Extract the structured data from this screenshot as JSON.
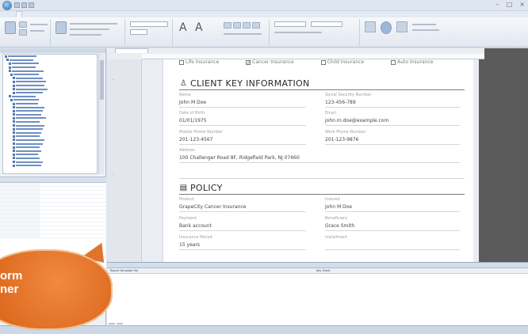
{
  "window": {
    "title": "",
    "controls": [
      "–",
      "□",
      "×"
    ]
  },
  "ribbon": {
    "tabs": [
      "",
      "",
      "",
      "",
      "",
      "",
      "",
      ""
    ],
    "groups": [
      "",
      "",
      "",
      "",
      "",
      ""
    ]
  },
  "doc": {
    "tab_label": "",
    "checkboxes": [
      {
        "label": "Life Insurance",
        "checked": false
      },
      {
        "label": "Cancer Insurance",
        "checked": true
      },
      {
        "label": "Child Insurance",
        "checked": false
      },
      {
        "label": "Auto Insurance",
        "checked": false
      }
    ],
    "section1": {
      "title": "CLIENT KEY INFORMATION",
      "fields": [
        {
          "label": "Name",
          "value": "John M Doe"
        },
        {
          "label": "Social Security Number",
          "value": "123-456-789"
        },
        {
          "label": "Date of Birth",
          "value": "01/01/1975"
        },
        {
          "label": "Email",
          "value": "john.m.doe@example.com"
        },
        {
          "label": "Mobile Phone Number",
          "value": "201-123-4567"
        },
        {
          "label": "Work Phone Number",
          "value": "201-123-9876"
        },
        {
          "label": "Address",
          "value": "100 Challenger Road 8F, Ridgefield Park, NJ 07660"
        }
      ]
    },
    "section2": {
      "title": "POLICY",
      "fields": [
        {
          "label": "Product",
          "value": "GrapeCity Cancer Insurance"
        },
        {
          "label": "Insured",
          "value": "John M Doe"
        },
        {
          "label": "Payment",
          "value": "Bank account"
        },
        {
          "label": "Beneficiary",
          "value": "Grace Smith"
        },
        {
          "label": "Insurance Period",
          "value": "15 years"
        },
        {
          "label": "Installment",
          "value": ""
        }
      ]
    }
  },
  "output": {
    "header": "",
    "col1": "Report template file",
    "col2": "Key Sheet",
    "row": "",
    "tabs": [
      "",
      ""
    ]
  },
  "callout": {
    "line1": "orm",
    "line2": "ner"
  }
}
